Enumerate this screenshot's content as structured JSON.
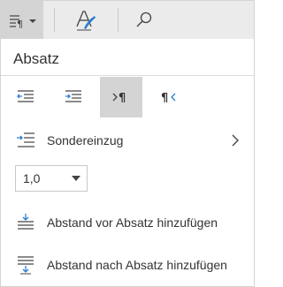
{
  "toolbar": {
    "items": [
      {
        "icon": "paragraph-format-icon",
        "active": true,
        "has_dropdown": true
      },
      {
        "icon": "text-style-icon",
        "active": false
      },
      {
        "icon": "search-icon",
        "active": false
      }
    ]
  },
  "section": {
    "title": "Absatz"
  },
  "indent_row": {
    "buttons": [
      {
        "icon": "decrease-indent-icon",
        "selected": false
      },
      {
        "icon": "increase-indent-icon",
        "selected": false
      },
      {
        "icon": "left-to-right-paragraph-icon",
        "selected": true
      },
      {
        "icon": "right-to-left-paragraph-icon",
        "selected": false
      }
    ]
  },
  "special_indent": {
    "label": "Sondereinzug",
    "icon": "special-indent-icon"
  },
  "line_spacing": {
    "value": "1,0"
  },
  "space_before": {
    "label": "Abstand vor Absatz hinzufügen",
    "icon": "space-before-icon"
  },
  "space_after": {
    "label": "Abstand nach Absatz hinzufügen",
    "icon": "space-after-icon"
  },
  "colors": {
    "accent": "#2b7cd3",
    "toolbar_bg": "#ebebeb",
    "selected_bg": "#d4d4d4",
    "text": "#333333"
  }
}
